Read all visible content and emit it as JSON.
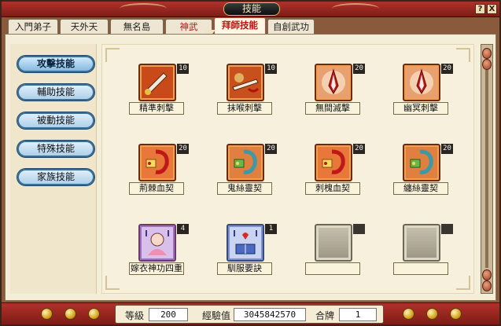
{
  "window": {
    "title": "技能",
    "help_glyph": "?",
    "close_glyph": "X"
  },
  "tabs": [
    {
      "label": "入門弟子"
    },
    {
      "label": "天外天"
    },
    {
      "label": "無名島"
    },
    {
      "label": "神武"
    },
    {
      "label": "拜師技能"
    },
    {
      "label": "自創武功"
    }
  ],
  "categories": [
    {
      "label": "攻擊技能"
    },
    {
      "label": "輔助技能"
    },
    {
      "label": "被動技能"
    },
    {
      "label": "特殊技能"
    },
    {
      "label": "家族技能"
    }
  ],
  "skills": [
    {
      "name": "精準刺擊",
      "level": "10",
      "icon": "dagger-thrust-icon"
    },
    {
      "name": "抹喉刺擊",
      "level": "10",
      "icon": "throat-slash-icon"
    },
    {
      "name": "無間滅擊",
      "level": "20",
      "icon": "spearhead-icon"
    },
    {
      "name": "幽冥刺擊",
      "level": "20",
      "icon": "spearhead-icon"
    },
    {
      "name": "荊棘血契",
      "level": "20",
      "icon": "blood-pact-icon"
    },
    {
      "name": "鬼絲靈契",
      "level": "20",
      "icon": "ghost-pact-icon"
    },
    {
      "name": "刺槐血契",
      "level": "20",
      "icon": "blood-pact-icon"
    },
    {
      "name": "纏絲靈契",
      "level": "20",
      "icon": "ghost-pact-icon"
    },
    {
      "name": "嫁衣神功四重",
      "level": "4",
      "icon": "doll-icon"
    },
    {
      "name": "馴服要訣",
      "level": "1",
      "icon": "taming-book-icon"
    },
    {
      "name": "",
      "level": "",
      "icon": "empty-slot-icon"
    },
    {
      "name": "",
      "level": "",
      "icon": "empty-slot-icon"
    }
  ],
  "stats": {
    "level_label": "等級",
    "level_value": "200",
    "exp_label": "經驗值",
    "exp_value": "3045842570",
    "token_label": "合牌",
    "token_value": "1"
  }
}
